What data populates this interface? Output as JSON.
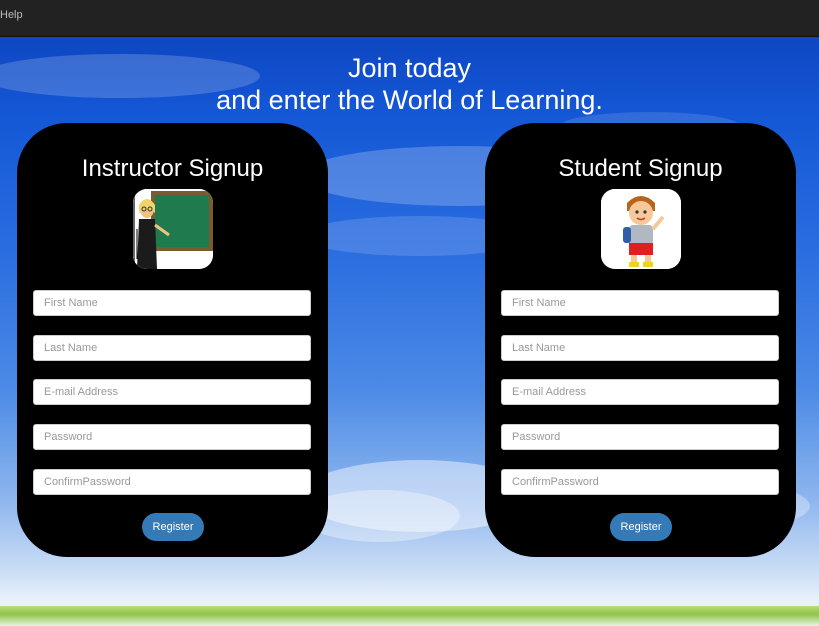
{
  "menubar": {
    "help": "Help"
  },
  "headline": {
    "line1": "Join today",
    "line2": "and enter the World of Learning."
  },
  "instructor": {
    "title": "Instructor Signup",
    "icon": "teacher-chalkboard-icon",
    "fields": {
      "first_name": "First Name",
      "last_name": "Last Name",
      "email": "E-mail Address",
      "password": "Password",
      "confirm": "ConfirmPassword"
    },
    "register": "Register"
  },
  "student": {
    "title": "Student Signup",
    "icon": "student-boy-icon",
    "fields": {
      "first_name": "First Name",
      "last_name": "Last Name",
      "email": "E-mail Address",
      "password": "Password",
      "confirm": "ConfirmPassword"
    },
    "register": "Register"
  },
  "colors": {
    "card": "#000000",
    "button": "#337ab7",
    "topbar": "#222222"
  }
}
